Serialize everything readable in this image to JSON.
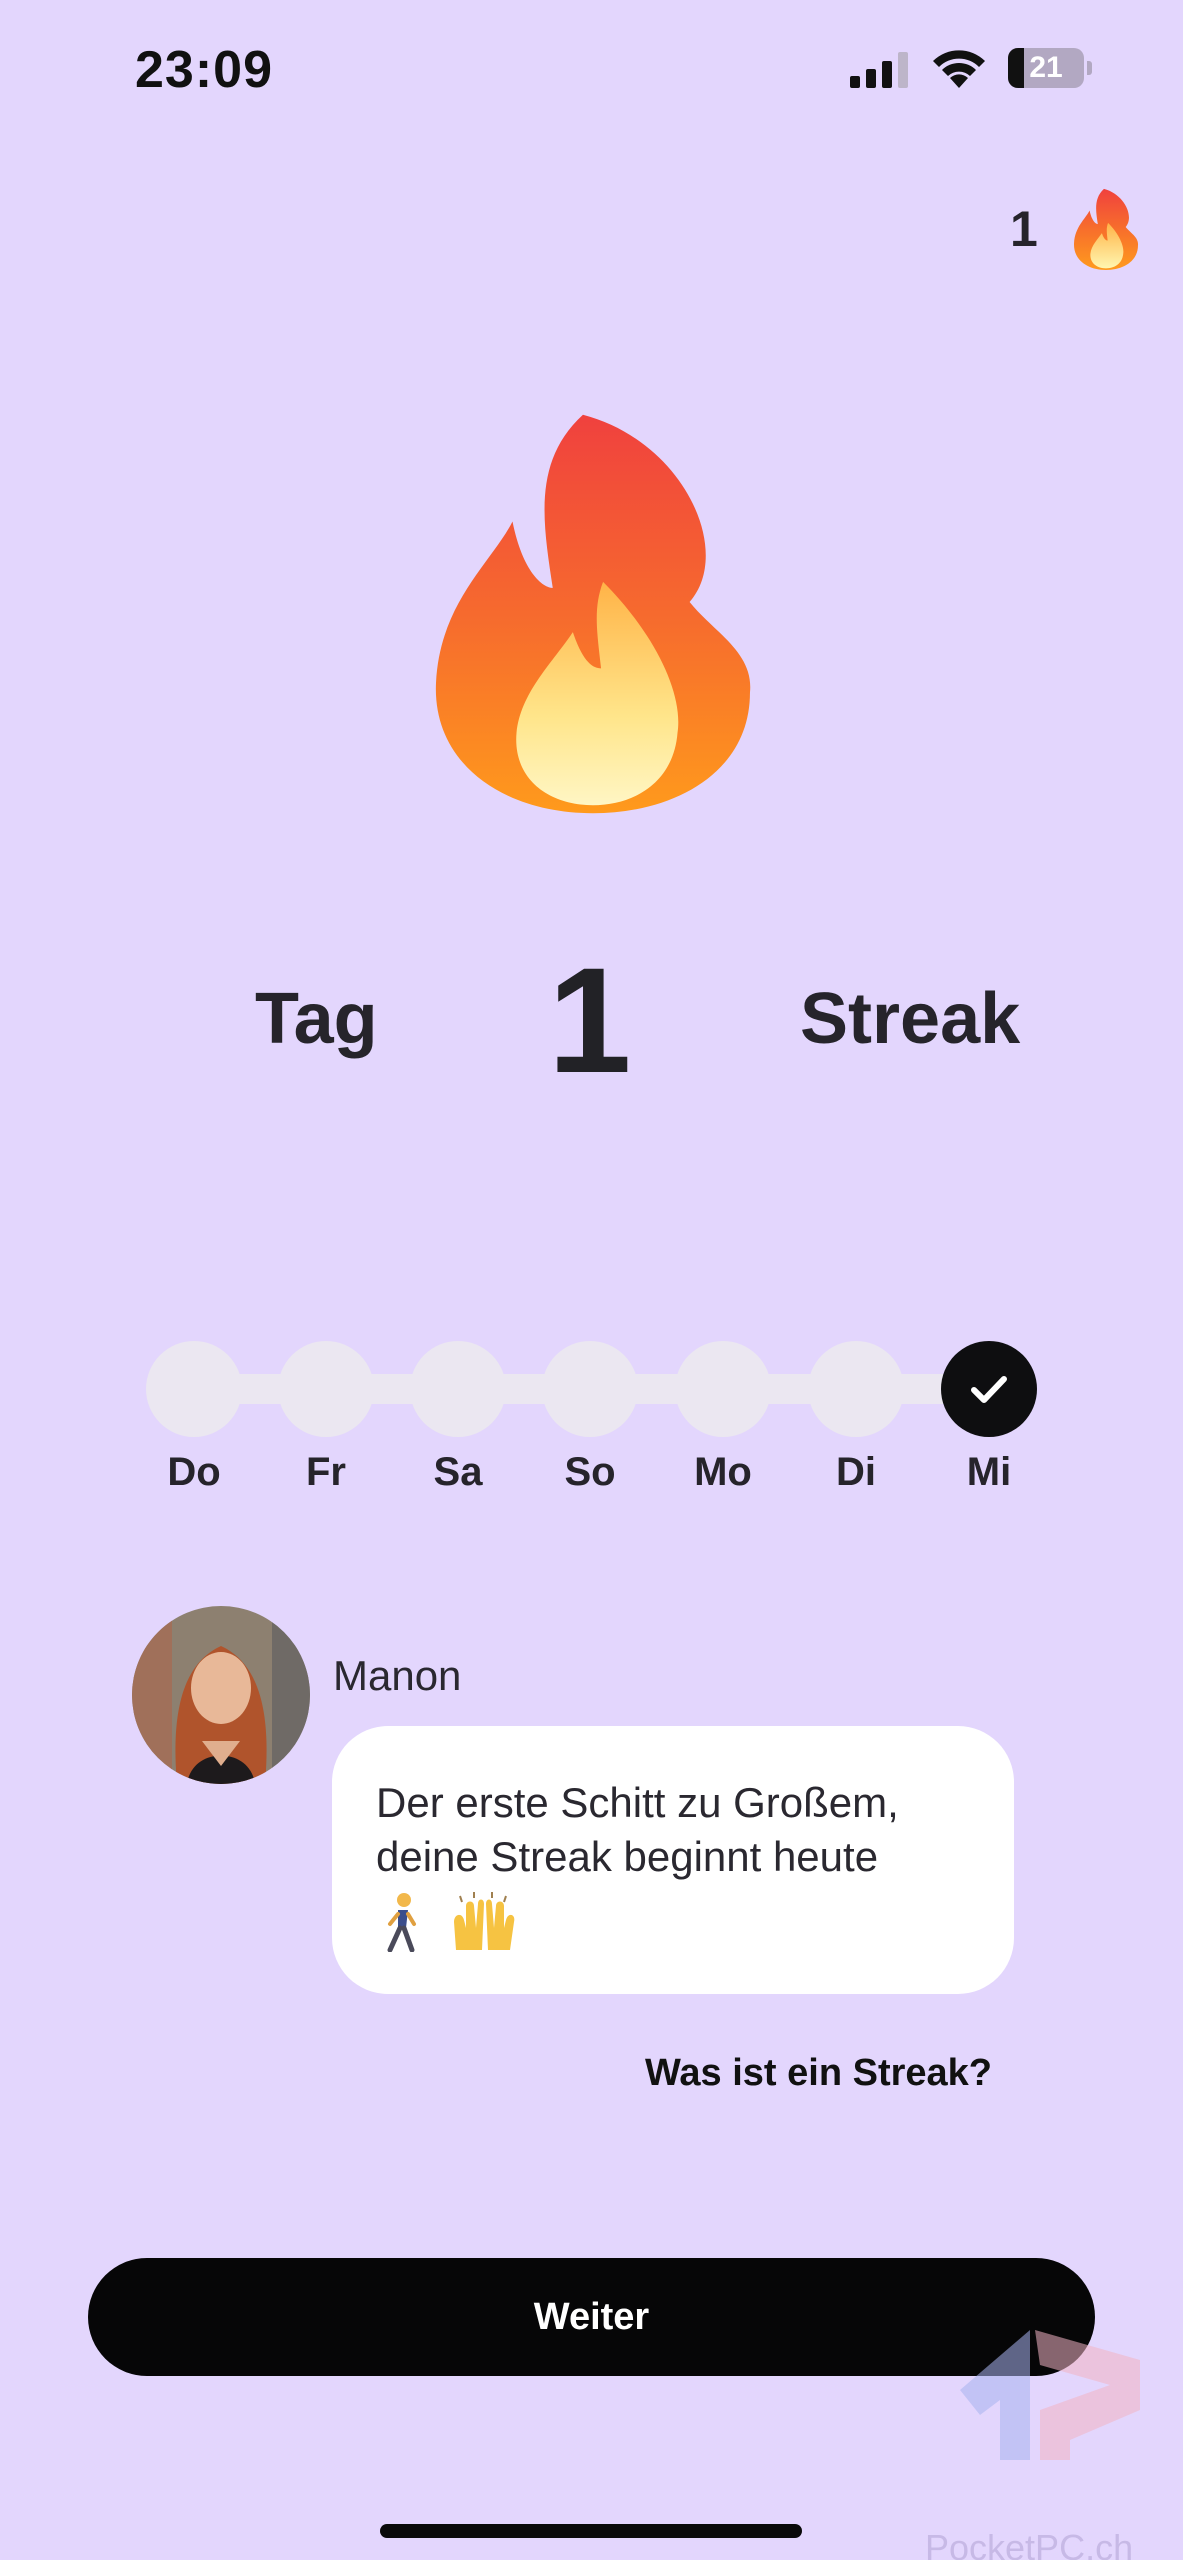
{
  "status_bar": {
    "time": "23:09",
    "battery_level": "21",
    "icons": [
      "cellular-signal-icon",
      "wifi-icon",
      "battery-icon"
    ]
  },
  "streak_badge": {
    "count": "1",
    "icon": "fire-icon"
  },
  "hero": {
    "icon": "fire-icon",
    "title_left": "Tag",
    "title_number": "1",
    "title_right": "Streak"
  },
  "week": {
    "days": [
      {
        "label": "Do",
        "done": false
      },
      {
        "label": "Fr",
        "done": false
      },
      {
        "label": "Sa",
        "done": false
      },
      {
        "label": "So",
        "done": false
      },
      {
        "label": "Mo",
        "done": false
      },
      {
        "label": "Di",
        "done": false
      },
      {
        "label": "Mi",
        "done": true
      }
    ]
  },
  "chat": {
    "sender": "Manon",
    "message_line1": "Der erste Schitt zu Großem,",
    "message_line2": "deine Streak beginnt heute",
    "emojis": [
      "person-walking-emoji",
      "raising-hands-emoji"
    ]
  },
  "help_link": "Was ist ein Streak?",
  "primary_button": "Weiter",
  "watermark": "PocketPC.ch",
  "colors": {
    "background": "#e3d6fd",
    "button": "#060607",
    "day_inactive": "#ebe7f1",
    "day_done": "#0e0e10",
    "bubble": "#ffffff"
  }
}
